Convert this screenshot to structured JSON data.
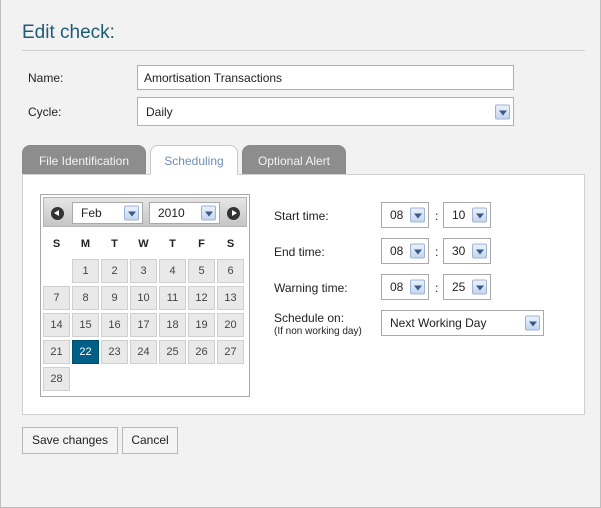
{
  "title": "Edit check:",
  "form": {
    "name_label": "Name:",
    "name_value": "Amortisation Transactions",
    "cycle_label": "Cycle:",
    "cycle_value": "Daily"
  },
  "tabs": [
    {
      "label": "File Identification",
      "active": false
    },
    {
      "label": "Scheduling",
      "active": true
    },
    {
      "label": "Optional Alert",
      "active": false
    }
  ],
  "calendar": {
    "month": "Feb",
    "year": "2010",
    "weekdays": [
      "S",
      "M",
      "T",
      "W",
      "T",
      "F",
      "S"
    ],
    "days": [
      "1",
      "2",
      "3",
      "4",
      "5",
      "6",
      "7",
      "8",
      "9",
      "10",
      "11",
      "12",
      "13",
      "14",
      "15",
      "16",
      "17",
      "18",
      "19",
      "20",
      "21",
      "22",
      "23",
      "24",
      "25",
      "26",
      "27",
      "28"
    ],
    "selected_day": "22"
  },
  "schedule": {
    "start_label": "Start time:",
    "start_hour": "08",
    "start_min": "10",
    "end_label": "End time:",
    "end_hour": "08",
    "end_min": "30",
    "warning_label": "Warning time:",
    "warning_hour": "08",
    "warning_min": "25",
    "separator": ":",
    "schedule_on_label": "Schedule on:",
    "schedule_on_sub": "(If non working day)",
    "schedule_on_value": "Next Working Day"
  },
  "buttons": {
    "save": "Save changes",
    "cancel": "Cancel"
  },
  "colors": {
    "title": "#1d5d74",
    "selected_day": "#005f86",
    "active_tab_text": "#6e8eb5",
    "cycle_border": "#d2b060"
  }
}
